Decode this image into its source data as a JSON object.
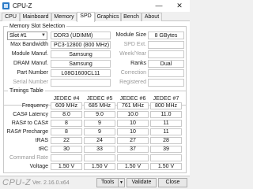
{
  "window": {
    "title": "CPU-Z",
    "minimize": "—",
    "close": "✕"
  },
  "tabs": [
    "CPU",
    "Mainboard",
    "Memory",
    "SPD",
    "Graphics",
    "Bench",
    "About"
  ],
  "active_tab": "SPD",
  "slot_section": {
    "title": "Memory Slot Selection",
    "slot_value": "Slot #1",
    "type_value": "DDR3 (UDIMM)",
    "left_fields": [
      {
        "label": "Max Bandwidth",
        "value": "PC3-12800 (800 MHz)"
      },
      {
        "label": "Module Manuf.",
        "value": "Samsung"
      },
      {
        "label": "DRAM Manuf.",
        "value": "Samsung"
      },
      {
        "label": "Part Number",
        "value": "L08G1600CL11"
      },
      {
        "label": "Serial Number",
        "value": ""
      }
    ],
    "module_size_label": "Module Size",
    "module_size_value": "8 GBytes",
    "spd_ext_label": "SPD Ext.",
    "week_year_label": "Week/Year",
    "ranks_label": "Ranks",
    "ranks_value": "Dual",
    "correction_label": "Correction",
    "registered_label": "Registered"
  },
  "timings": {
    "title": "Timings Table",
    "columns": [
      "JEDEC #4",
      "JEDEC #5",
      "JEDEC #6",
      "JEDEC #7"
    ],
    "rows": [
      {
        "label": "Frequency",
        "values": [
          "609 MHz",
          "685 MHz",
          "761 MHz",
          "800 MHz"
        ]
      },
      {
        "label": "CAS# Latency",
        "values": [
          "8.0",
          "9.0",
          "10.0",
          "11.0"
        ]
      },
      {
        "label": "RAS# to CAS#",
        "values": [
          "8",
          "9",
          "10",
          "11"
        ]
      },
      {
        "label": "RAS# Precharge",
        "values": [
          "8",
          "9",
          "10",
          "11"
        ]
      },
      {
        "label": "tRAS",
        "values": [
          "22",
          "24",
          "27",
          "28"
        ]
      },
      {
        "label": "tRC",
        "values": [
          "30",
          "33",
          "37",
          "39"
        ]
      },
      {
        "label": "Command Rate",
        "values": [
          "",
          "",
          "",
          ""
        ]
      },
      {
        "label": "Voltage",
        "values": [
          "1.50 V",
          "1.50 V",
          "1.50 V",
          "1.50 V"
        ]
      }
    ]
  },
  "footer": {
    "brand": "CPU-Z",
    "version": "Ver. 2.16.0.x64",
    "tools_label": "Tools",
    "validate_label": "Validate",
    "close_label": "Close"
  }
}
